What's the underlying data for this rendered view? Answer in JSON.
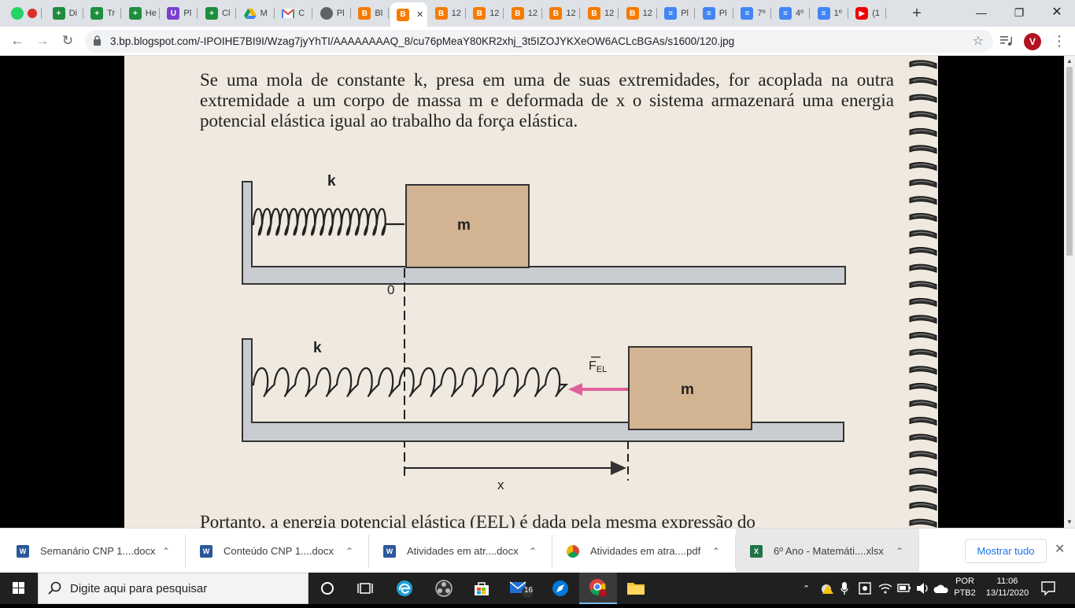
{
  "tabs": [
    {
      "icon": "whatsapp-icon",
      "label": ""
    },
    {
      "icon": "sheets-icon",
      "label": "Di"
    },
    {
      "icon": "sheets-icon",
      "label": "Tr"
    },
    {
      "icon": "sheets-icon",
      "label": "He"
    },
    {
      "icon": "ud-icon",
      "label": "Pl"
    },
    {
      "icon": "sheets-icon",
      "label": "Cl"
    },
    {
      "icon": "drive-icon",
      "label": "M"
    },
    {
      "icon": "gmail-icon",
      "label": "C"
    },
    {
      "icon": "globe-icon",
      "label": "Pl"
    },
    {
      "icon": "blogger-icon",
      "label": "Bl"
    },
    {
      "icon": "blogger-icon",
      "label": ""
    },
    {
      "icon": "blogger-icon",
      "label": "12"
    },
    {
      "icon": "blogger-icon",
      "label": "12"
    },
    {
      "icon": "blogger-icon",
      "label": "12"
    },
    {
      "icon": "blogger-icon",
      "label": "12"
    },
    {
      "icon": "blogger-icon",
      "label": "12"
    },
    {
      "icon": "blogger-icon",
      "label": "12"
    },
    {
      "icon": "docs-icon",
      "label": "Pl"
    },
    {
      "icon": "docs-icon",
      "label": "Pl"
    },
    {
      "icon": "docs-icon",
      "label": "7º"
    },
    {
      "icon": "docs-icon",
      "label": "4º"
    },
    {
      "icon": "docs-icon",
      "label": "1º"
    },
    {
      "icon": "youtube-icon",
      "label": "(1"
    }
  ],
  "active_tab_index": 10,
  "toolbar": {
    "url": "3.bp.blogspot.com/-IPOIHE7BI9I/Wzag7jyYhTI/AAAAAAAAQ_8/cu76pMeaY80KR2xhj_3t5IZOJYKXeOW6ACLcBGAs/s1600/120.jpg",
    "avatar_letter": "V"
  },
  "page": {
    "paragraph1": "Se uma mola de constante k, presa em uma de suas extremidades, for acoplada na outra extremidade a um corpo de massa m e deformada de x o sistema armazenará uma energia potencial elástica igual ao trabalho da força elástica.",
    "paragraph2": "Portanto, a energia potencial elástica (EEL) é dada pela mesma expressão do",
    "diagram": {
      "spring_label": "k",
      "mass_label": "m",
      "origin_label": "0",
      "displacement_label": "x",
      "force_label": "F",
      "force_subscript": "EL"
    }
  },
  "downloads": [
    {
      "name": "Semanário CNP 1....docx",
      "type": "word"
    },
    {
      "name": "Conteúdo CNP 1....docx",
      "type": "word"
    },
    {
      "name": "Atividades em atr....docx",
      "type": "word"
    },
    {
      "name": "Atividades em atra....pdf",
      "type": "chrome"
    },
    {
      "name": "6º Ano - Matemáti....xlsx",
      "type": "xls"
    }
  ],
  "downloads_show_all": "Mostrar tudo",
  "taskbar": {
    "search_placeholder": "Digite aqui para pesquisar",
    "mail_badge": "16",
    "lang_line1": "POR",
    "lang_line2": "PTB2",
    "time": "11:06",
    "date": "13/11/2020"
  },
  "colors": {
    "tabstrip": "#dee1e6",
    "paper": "#efe9df",
    "block": "#d2b492",
    "force_arrow": "#e0609a",
    "link": "#1a73e8"
  }
}
